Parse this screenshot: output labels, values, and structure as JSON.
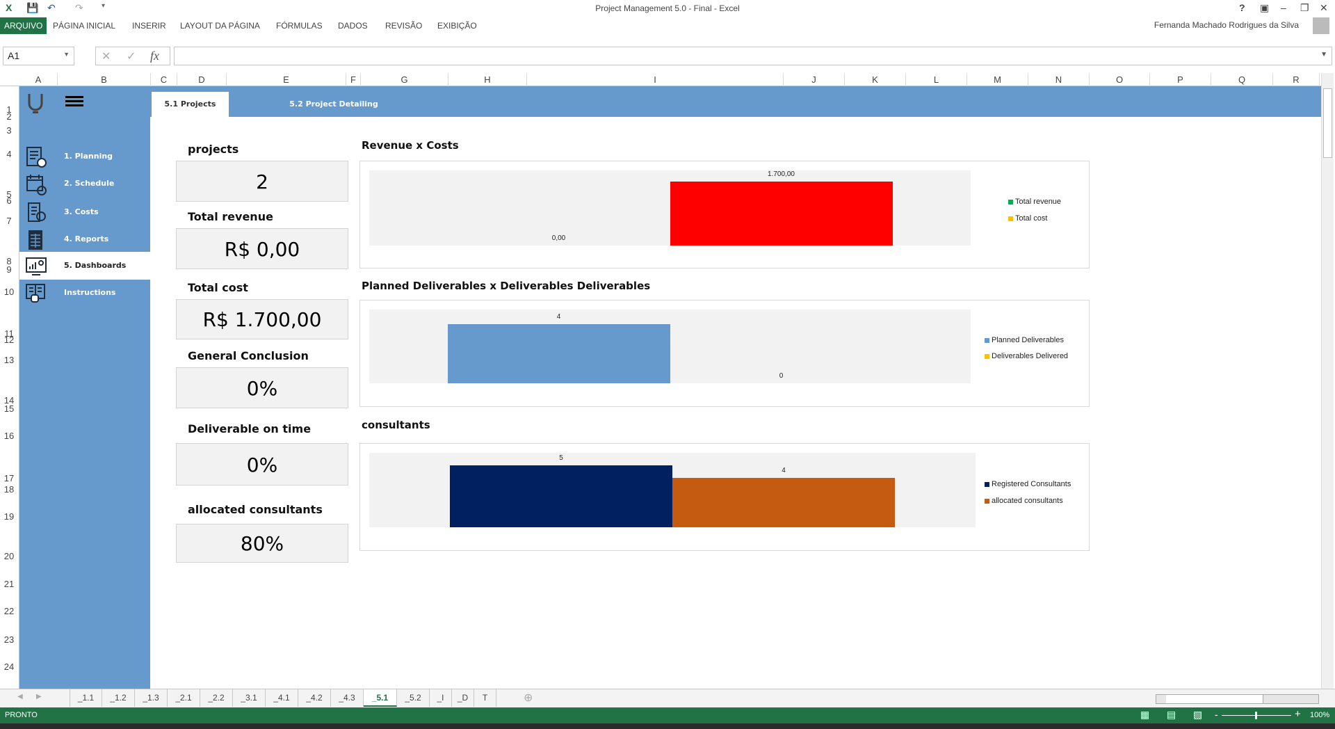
{
  "window": {
    "title": "Project Management 5.0 - Final - Excel",
    "user": "Fernanda Machado Rodrigues da Silva"
  },
  "ribbon": {
    "tabs": [
      "ARQUIVO",
      "PÁGINA INICIAL",
      "INSERIR",
      "LAYOUT DA PÁGINA",
      "FÓRMULAS",
      "DADOS",
      "REVISÃO",
      "EXIBIÇÃO"
    ]
  },
  "formula_bar": {
    "name_box": "A1",
    "fx": "fx",
    "value": ""
  },
  "columns": [
    "A",
    "B",
    "C",
    "D",
    "E",
    "F",
    "G",
    "H",
    "I",
    "J",
    "K",
    "L",
    "M",
    "N",
    "O",
    "P",
    "Q",
    "R"
  ],
  "rows": [
    "1",
    "2",
    "3",
    "4",
    "5",
    "6",
    "7",
    "8",
    "9",
    "10",
    "11",
    "12",
    "13",
    "14",
    "15",
    "16",
    "17",
    "18",
    "19",
    "20",
    "21",
    "22",
    "23",
    "24"
  ],
  "page_tabs": [
    "5.1 Projects",
    "5.2 Project Detailing"
  ],
  "nav": [
    {
      "label": "1. Planning",
      "icon": "planning-icon"
    },
    {
      "label": "2. Schedule",
      "icon": "calendar-icon"
    },
    {
      "label": "3. Costs",
      "icon": "costs-icon"
    },
    {
      "label": "4. Reports",
      "icon": "reports-icon"
    },
    {
      "label": "5. Dashboards",
      "icon": "dashboard-icon"
    },
    {
      "label": "Instructions",
      "icon": "instructions-icon"
    }
  ],
  "kpis": [
    {
      "label": "projects",
      "value": "2"
    },
    {
      "label": "Total revenue",
      "value": "R$ 0,00"
    },
    {
      "label": "Total cost",
      "value": "R$ 1.700,00"
    },
    {
      "label": "General Conclusion",
      "value": "0%"
    },
    {
      "label": "Deliverable on time",
      "value": "0%"
    },
    {
      "label": "allocated consultants",
      "value": "80%"
    }
  ],
  "chart_data": [
    {
      "type": "bar",
      "title": "Revenue x Costs",
      "ylim": [
        0,
        2000
      ],
      "legend": "right",
      "series": [
        {
          "name": "Total revenue",
          "value": 0,
          "label": "0,00",
          "color": "#00b050",
          "bar_color": "#00b050"
        },
        {
          "name": "Total cost",
          "value": 1700,
          "label": "1.700,00",
          "color": "#ffc000",
          "bar_color": "#ff0000"
        }
      ]
    },
    {
      "type": "bar",
      "title": "Planned Deliverables x Deliverables Deliverables",
      "ylim": [
        0,
        5
      ],
      "legend": "right",
      "series": [
        {
          "name": "Planned Deliverables",
          "value": 4,
          "label": "4",
          "color": "#6699cc",
          "bar_color": "#6699cc"
        },
        {
          "name": "Deliverables Delivered",
          "value": 0,
          "label": "0",
          "color": "#ffc000",
          "bar_color": "#ffc000"
        }
      ]
    },
    {
      "type": "bar",
      "title": "consultants",
      "ylim": [
        0,
        6
      ],
      "legend": "right",
      "series": [
        {
          "name": "Registered Consultants",
          "value": 5,
          "label": "5",
          "color": "#002060",
          "bar_color": "#002060"
        },
        {
          "name": "allocated consultants",
          "value": 4,
          "label": "4",
          "color": "#c55a11",
          "bar_color": "#c55a11"
        }
      ]
    }
  ],
  "sheet_tabs": [
    "_1.1",
    "_1.2",
    "_1.3",
    "_2.1",
    "_2.2",
    "_3.1",
    "_4.1",
    "_4.2",
    "_4.3",
    "_5.1",
    "_5.2",
    "_I",
    "_D",
    "T"
  ],
  "active_sheet": "_5.1",
  "status": {
    "text": "PRONTO",
    "zoom": "100%"
  }
}
